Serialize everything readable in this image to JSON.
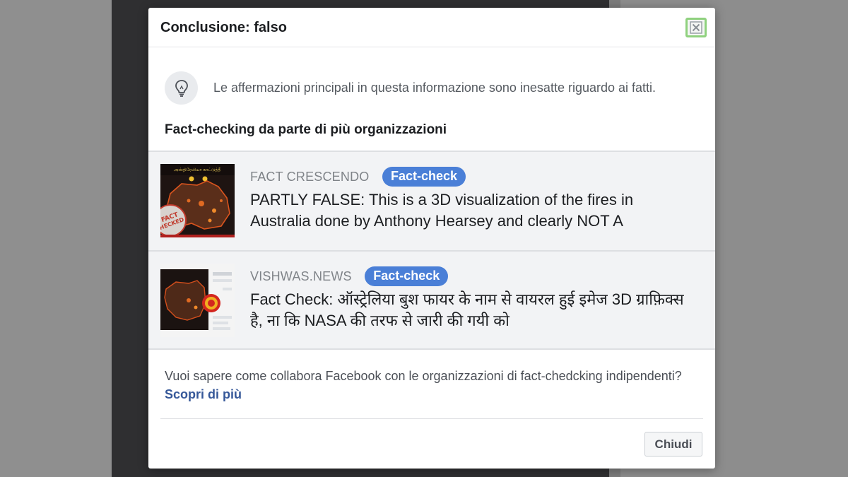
{
  "dialog": {
    "title": "Conclusione: falso",
    "info_text": "Le affermazioni principali in questa informazione sono inesatte riguardo ai fatti.",
    "section_heading": "Fact-checking da parte di più organizzazioni",
    "fact_checks": [
      {
        "publisher": "FACT CRESCENDO",
        "badge": "Fact-check",
        "headline": "PARTLY FALSE: This is a 3D visualization of the fires in Australia done by Anthony Hearsey and clearly NOT A",
        "thumbnail_text": "அஸ்திரேலியா காட்டுத்தீ"
      },
      {
        "publisher": "VISHWAS.NEWS",
        "badge": "Fact-check",
        "headline": "Fact Check: ऑस्ट्रेलिया बुश फायर के नाम से वायरल हुई इमेज 3D ग्राफ़िक्स है, ना कि NASA की तरफ से जारी की गयी को"
      }
    ],
    "footer_text": "Vuoi sapere come collabora Facebook con le organizzazioni di fact-chedcking indipendenti? ",
    "footer_link": "Scopri di più",
    "close_button": "Chiudi"
  },
  "icons": {
    "close": "close-icon",
    "bulb": "lightbulb-icon"
  },
  "colors": {
    "badge": "#4a7fd7",
    "link": "#365899",
    "close_outline": "#8fd17e"
  }
}
